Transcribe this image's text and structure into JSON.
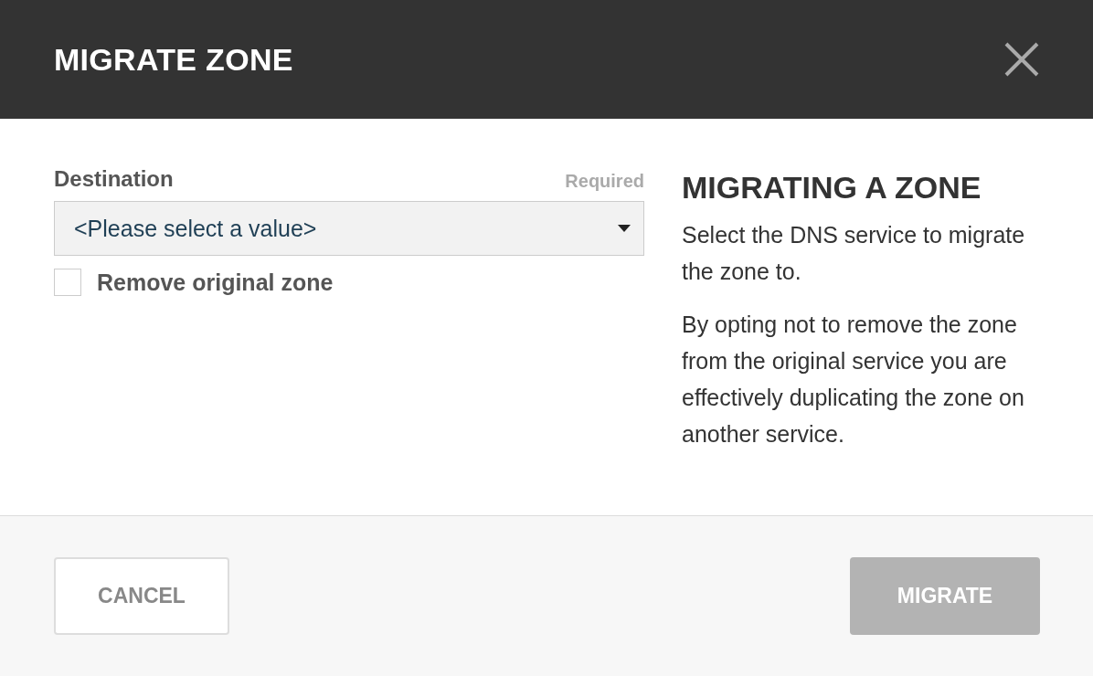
{
  "dialog": {
    "title": "MIGRATE ZONE"
  },
  "form": {
    "destination": {
      "label": "Destination",
      "required_note": "Required",
      "value": "<Please select a value>"
    },
    "remove_original": {
      "label": "Remove original zone",
      "checked": false
    }
  },
  "help": {
    "heading": "MIGRATING A ZONE",
    "paragraphs": [
      "Select the DNS service to migrate the zone to.",
      "By opting not to remove the zone from the original service you are effectively duplicating the zone on another service."
    ]
  },
  "buttons": [
    {
      "label": "CANCEL",
      "kind": "secondary",
      "disabled": false
    },
    {
      "label": "MIGRATE",
      "kind": "primary",
      "disabled": true
    }
  ]
}
